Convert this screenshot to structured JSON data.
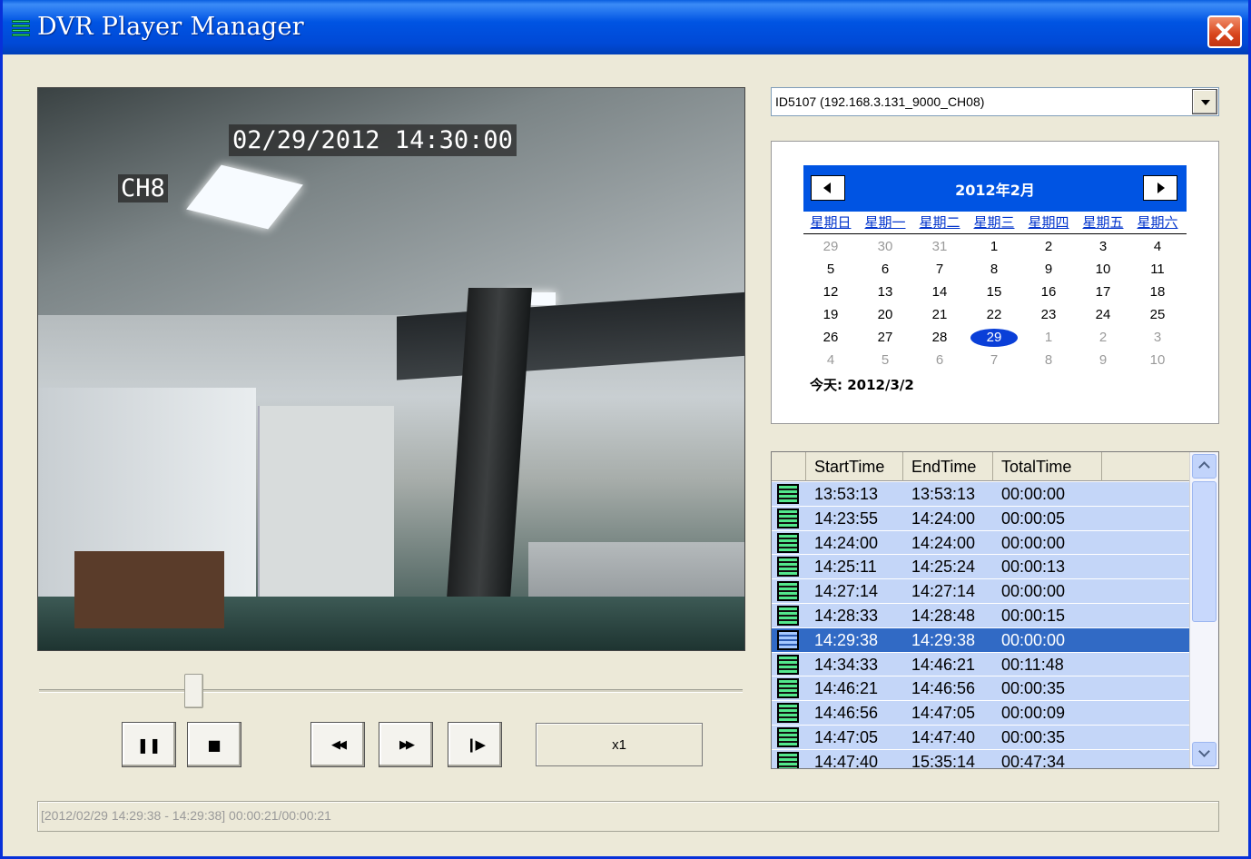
{
  "window": {
    "title": "DVR Player Manager"
  },
  "video": {
    "osd_date": "02/29/2012 14:30:00",
    "osd_channel": "CH8"
  },
  "playback": {
    "position": 0.22,
    "buttons": {
      "pause": "❚❚",
      "stop": "■",
      "rewind": "◀◀",
      "fast_forward": "▶▶",
      "step": "❙▶"
    },
    "speed": "x1"
  },
  "device_select": {
    "value": "ID5107 (192.168.3.131_9000_CH08)"
  },
  "calendar": {
    "month_title": "2012年2月",
    "weekdays": [
      "星期日",
      "星期一",
      "星期二",
      "星期三",
      "星期四",
      "星期五",
      "星期六"
    ],
    "weeks": [
      [
        [
          "29",
          1
        ],
        [
          "30",
          1
        ],
        [
          "31",
          1
        ],
        [
          "1",
          0
        ],
        [
          "2",
          0
        ],
        [
          "3",
          0
        ],
        [
          "4",
          0
        ]
      ],
      [
        [
          "5",
          0
        ],
        [
          "6",
          0
        ],
        [
          "7",
          0
        ],
        [
          "8",
          0
        ],
        [
          "9",
          0
        ],
        [
          "10",
          0
        ],
        [
          "11",
          0
        ]
      ],
      [
        [
          "12",
          0
        ],
        [
          "13",
          0
        ],
        [
          "14",
          0
        ],
        [
          "15",
          0
        ],
        [
          "16",
          0
        ],
        [
          "17",
          0
        ],
        [
          "18",
          0
        ]
      ],
      [
        [
          "19",
          0
        ],
        [
          "20",
          0
        ],
        [
          "21",
          0
        ],
        [
          "22",
          0
        ],
        [
          "23",
          0
        ],
        [
          "24",
          0
        ],
        [
          "25",
          0
        ]
      ],
      [
        [
          "26",
          0
        ],
        [
          "27",
          0
        ],
        [
          "28",
          0
        ],
        [
          "29",
          2
        ],
        [
          "1",
          1
        ],
        [
          "2",
          1
        ],
        [
          "3",
          1
        ]
      ],
      [
        [
          "4",
          1
        ],
        [
          "5",
          1
        ],
        [
          "6",
          1
        ],
        [
          "7",
          1
        ],
        [
          "8",
          1
        ],
        [
          "9",
          1
        ],
        [
          "10",
          1
        ]
      ]
    ],
    "today_label": "今天: 2012/3/2"
  },
  "recordings": {
    "columns": [
      "",
      "StartTime",
      "EndTime",
      "TotalTime"
    ],
    "selected_index": 6,
    "rows": [
      [
        "13:53:13",
        "13:53:13",
        "00:00:00"
      ],
      [
        "14:23:55",
        "14:24:00",
        "00:00:05"
      ],
      [
        "14:24:00",
        "14:24:00",
        "00:00:00"
      ],
      [
        "14:25:11",
        "14:25:24",
        "00:00:13"
      ],
      [
        "14:27:14",
        "14:27:14",
        "00:00:00"
      ],
      [
        "14:28:33",
        "14:28:48",
        "00:00:15"
      ],
      [
        "14:29:38",
        "14:29:38",
        "00:00:00"
      ],
      [
        "14:34:33",
        "14:46:21",
        "00:11:48"
      ],
      [
        "14:46:21",
        "14:46:56",
        "00:00:35"
      ],
      [
        "14:46:56",
        "14:47:05",
        "00:00:09"
      ],
      [
        "14:47:05",
        "14:47:40",
        "00:00:35"
      ],
      [
        "14:47:40",
        "15:35:14",
        "00:47:34"
      ]
    ]
  },
  "status": {
    "text": "[2012/02/29 14:29:38 - 14:29:38] 00:00:21/00:00:21"
  }
}
